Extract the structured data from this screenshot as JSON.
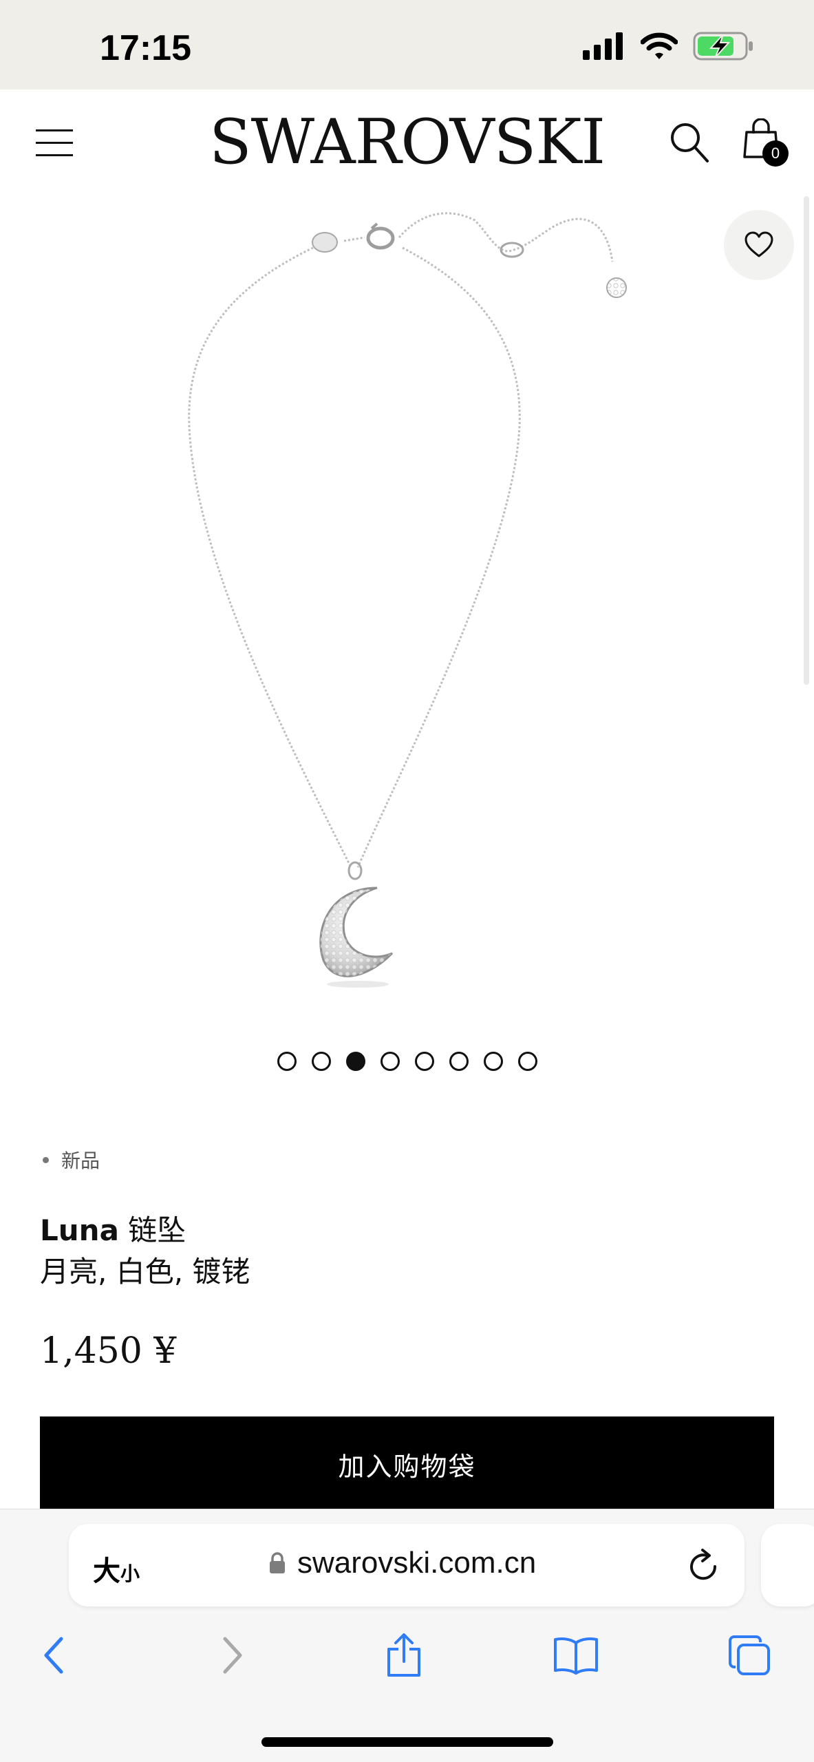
{
  "status_bar": {
    "time": "17:15"
  },
  "header": {
    "brand": "SWAROVSKI",
    "bag_count": "0"
  },
  "gallery": {
    "total_images": 8,
    "active_index": 2
  },
  "product": {
    "badge": "新品",
    "name": "Luna",
    "category": "链坠",
    "variant": "月亮, 白色, 镀铑",
    "price": "1,450 ¥"
  },
  "actions": {
    "add_to_bag_label": "加入购物袋"
  },
  "browser": {
    "text_size_big": "大",
    "text_size_small": "小",
    "url": "swarovski.com.cn"
  },
  "colors": {
    "accent": "#000000",
    "link_blue": "#2f7cf6",
    "status_bg": "#efeee9",
    "battery_green": "#4cd964"
  }
}
